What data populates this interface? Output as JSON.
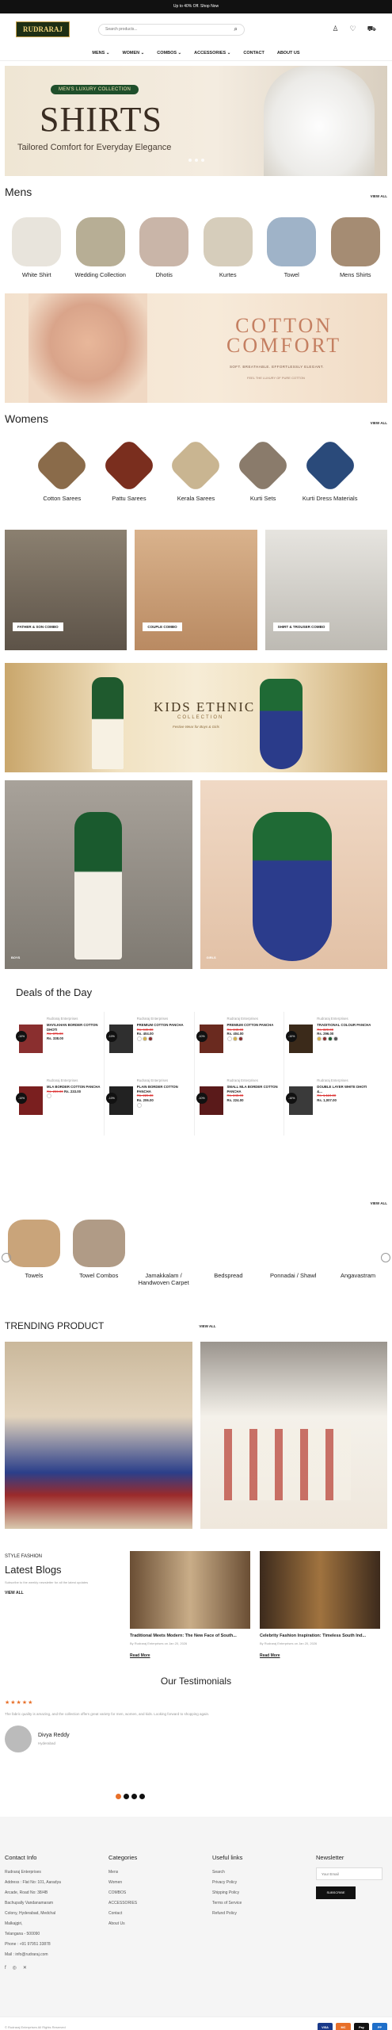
{
  "topbar": {
    "text": "Up to 40% Off. Shop Now"
  },
  "header": {
    "logo": "RUDRARAJ",
    "search_placeholder": "Search products..."
  },
  "nav": [
    "MENS ⌄",
    "WOMEN ⌄",
    "COMBOS ⌄",
    "ACCESSORIES ⌄",
    "CONTACT",
    "ABOUT US"
  ],
  "hero": {
    "badge": "MEN'S LUXURY COLLECTION",
    "title": "SHIRTS",
    "subtitle": "Tailored Comfort for Everyday Elegance"
  },
  "mens": {
    "title": "Mens",
    "view_all": "VIEW ALL",
    "items": [
      {
        "label": "White Shirt",
        "color": "#e8e4dc"
      },
      {
        "label": "Wedding Collection",
        "color": "#b7ae95"
      },
      {
        "label": "Dhotis",
        "color": "#c9b5a8"
      },
      {
        "label": "Kurtes",
        "color": "#d6cdbb"
      },
      {
        "label": "Towel",
        "color": "#9fb3c8"
      },
      {
        "label": "Mens Shirts",
        "color": "#a58c73"
      }
    ]
  },
  "cotton_banner": {
    "title_line1": "COTTON",
    "title_line2": "COMFORT",
    "tagline": "SOFT. BREATHABLE. EFFORTLESSLY ELEGANT.",
    "small": "FEEL THE LUXURY OF PURE COTTON"
  },
  "womens": {
    "title": "Womens",
    "view_all": "VIEW ALL",
    "items": [
      {
        "label": "Cotton Sarees",
        "color": "#8a6b4a"
      },
      {
        "label": "Pattu Sarees",
        "color": "#7a2e1e"
      },
      {
        "label": "Kerala Sarees",
        "color": "#c9b591"
      },
      {
        "label": "Kurti Sets",
        "color": "#8a7b6b"
      },
      {
        "label": "Kurti Dress Materials",
        "color": "#2a4a7a"
      }
    ]
  },
  "combos": [
    {
      "label": "FATHER & SON COMBO",
      "color": "#6d6358"
    },
    {
      "label": "COUPLE COMBO",
      "color": "#c49a72"
    },
    {
      "label": "SHIRT & TROUSER COMBO",
      "color": "#cfcdc8"
    }
  ],
  "kids_banner": {
    "title": "KIDS ETHNIC",
    "subtitle": "COLLECTION",
    "tagline": "Festive Wear for Boys & Girls"
  },
  "kids_tiles": [
    {
      "label": "BOYS"
    },
    {
      "label": "GIRLS"
    }
  ],
  "deals": {
    "title": "Deals of the Day",
    "items": [
      {
        "brand": "Rudraraj Enterprises",
        "name": "MAYILKHAN BORDER COTTON DHOTI",
        "old": "Rs. 375.00",
        "new": "Rs. 338.00",
        "badge": "-10%",
        "color": "#8a2f2f"
      },
      {
        "brand": "Rudraraj Enterprises",
        "name": "PREMIUM COTTON PANCHA",
        "old": "Rs. 449.00",
        "new": "Rs. 404.00",
        "badge": "-10%",
        "color": "#2f2f2f"
      },
      {
        "brand": "Rudraraj Enterprises",
        "name": "PREMIUM COTTON PANCHA",
        "old": "Rs. 449.00",
        "new": "Rs. 404.00",
        "badge": "-10%",
        "color": "#6a2a1f"
      },
      {
        "brand": "Rudraraj Enterprises",
        "name": "TRADITIONAL COLOUR PANCHA",
        "old": "Rs. 329.00",
        "new": "Rs. 296.00",
        "badge": "-10%",
        "color": "#3b2a1a"
      },
      {
        "brand": "Rudraraj Enterprises",
        "name": "MLA BORDER COTTON PANCHA",
        "old": "Rs. 259.00",
        "new": "Rs. 233.00",
        "badge": "-10%",
        "color": "#7a1f1f"
      },
      {
        "brand": "Rudraraj Enterprises",
        "name": "PLAIN BORDER COTTON PANCHA",
        "old": "Rs. 229.00",
        "new": "Rs. 206.00",
        "badge": "-10%",
        "color": "#222222"
      },
      {
        "brand": "Rudraraj Enterprises",
        "name": "SMALL MLA BORDER COTTON PANCHA",
        "old": "Rs. 249.00",
        "new": "Rs. 224.00",
        "badge": "-10%",
        "color": "#5a1a1a"
      },
      {
        "brand": "Rudraraj Enterprises",
        "name": "DOUBLE LAYER WHITE DHOTI &...",
        "old": "Rs. 1,119.00",
        "new": "Rs. 1,007.00",
        "badge": "-10%",
        "color": "#3a3a3a"
      }
    ]
  },
  "home": {
    "view_all": "VIEW ALL",
    "items": [
      {
        "label": "Towels",
        "color": "#c9a47a"
      },
      {
        "label": "Towel Combos",
        "color": "#b09b86"
      },
      {
        "label": "Jamakkalam / Handwoven Carpet",
        "color": ""
      },
      {
        "label": "Bedspread",
        "color": ""
      },
      {
        "label": "Ponnadai / Shawl",
        "color": ""
      },
      {
        "label": "Angavastram",
        "color": ""
      }
    ]
  },
  "trending": {
    "title": "TRENDING PRODUCT",
    "view_all": "VIEW ALL"
  },
  "blogs": {
    "kicker": "STYLE FASHION",
    "title": "Latest Blogs",
    "desc": "Subscribe to the weekly newsletter for all the latest updates",
    "view_all": "VIEW ALL",
    "posts": [
      {
        "title": "Traditional Meets Modern: The New Face of South...",
        "meta": "By Rudraraj Enterprises on Jan 20, 2026",
        "read": "Read More"
      },
      {
        "title": "Celebrity Fashion Inspiration: Timeless South Ind...",
        "meta": "By Rudraraj Enterprises on Jan 20, 2026",
        "read": "Read More"
      }
    ]
  },
  "testimonials": {
    "title": "Our Testimonials",
    "stars": "★★★★★",
    "quote": "The fabric quality is amazing, and the collection offers great variety for men, women, and kids. Looking forward to shopping again.",
    "name": "Divya Reddy",
    "city": "Hyderabad"
  },
  "footer": {
    "contact_title": "Contact Info",
    "contact_lines": [
      "Rudraraj Enterprises",
      "Address : Flat No: 101, Aaradya",
      "Arcade, Road No: 38/4B",
      "Bachupally Vandanamaram",
      "Colony, Hyderabad, Medchal",
      "Malkajgiri,",
      "Telangana - 500090",
      "Phone : +91 97951 33878",
      "Mail : info@rudraraj.com"
    ],
    "cat_title": "Categories",
    "cats": [
      "Mens",
      "Women",
      "COMBOS",
      "ACCESSORIES",
      "Contact",
      "About Us"
    ],
    "links_title": "Useful links",
    "links": [
      "Search",
      "Privacy Policy",
      "Shipping Policy",
      "Terms of Service",
      "Refund Policy"
    ],
    "news_title": "Newsletter",
    "news_placeholder": "Your Email",
    "news_button": "SUBSCRIBE",
    "copyright": "© Rudraraj Enterprises All Rights Reserved",
    "payments": [
      "VISA",
      "MC",
      "Pay",
      "PP"
    ]
  }
}
